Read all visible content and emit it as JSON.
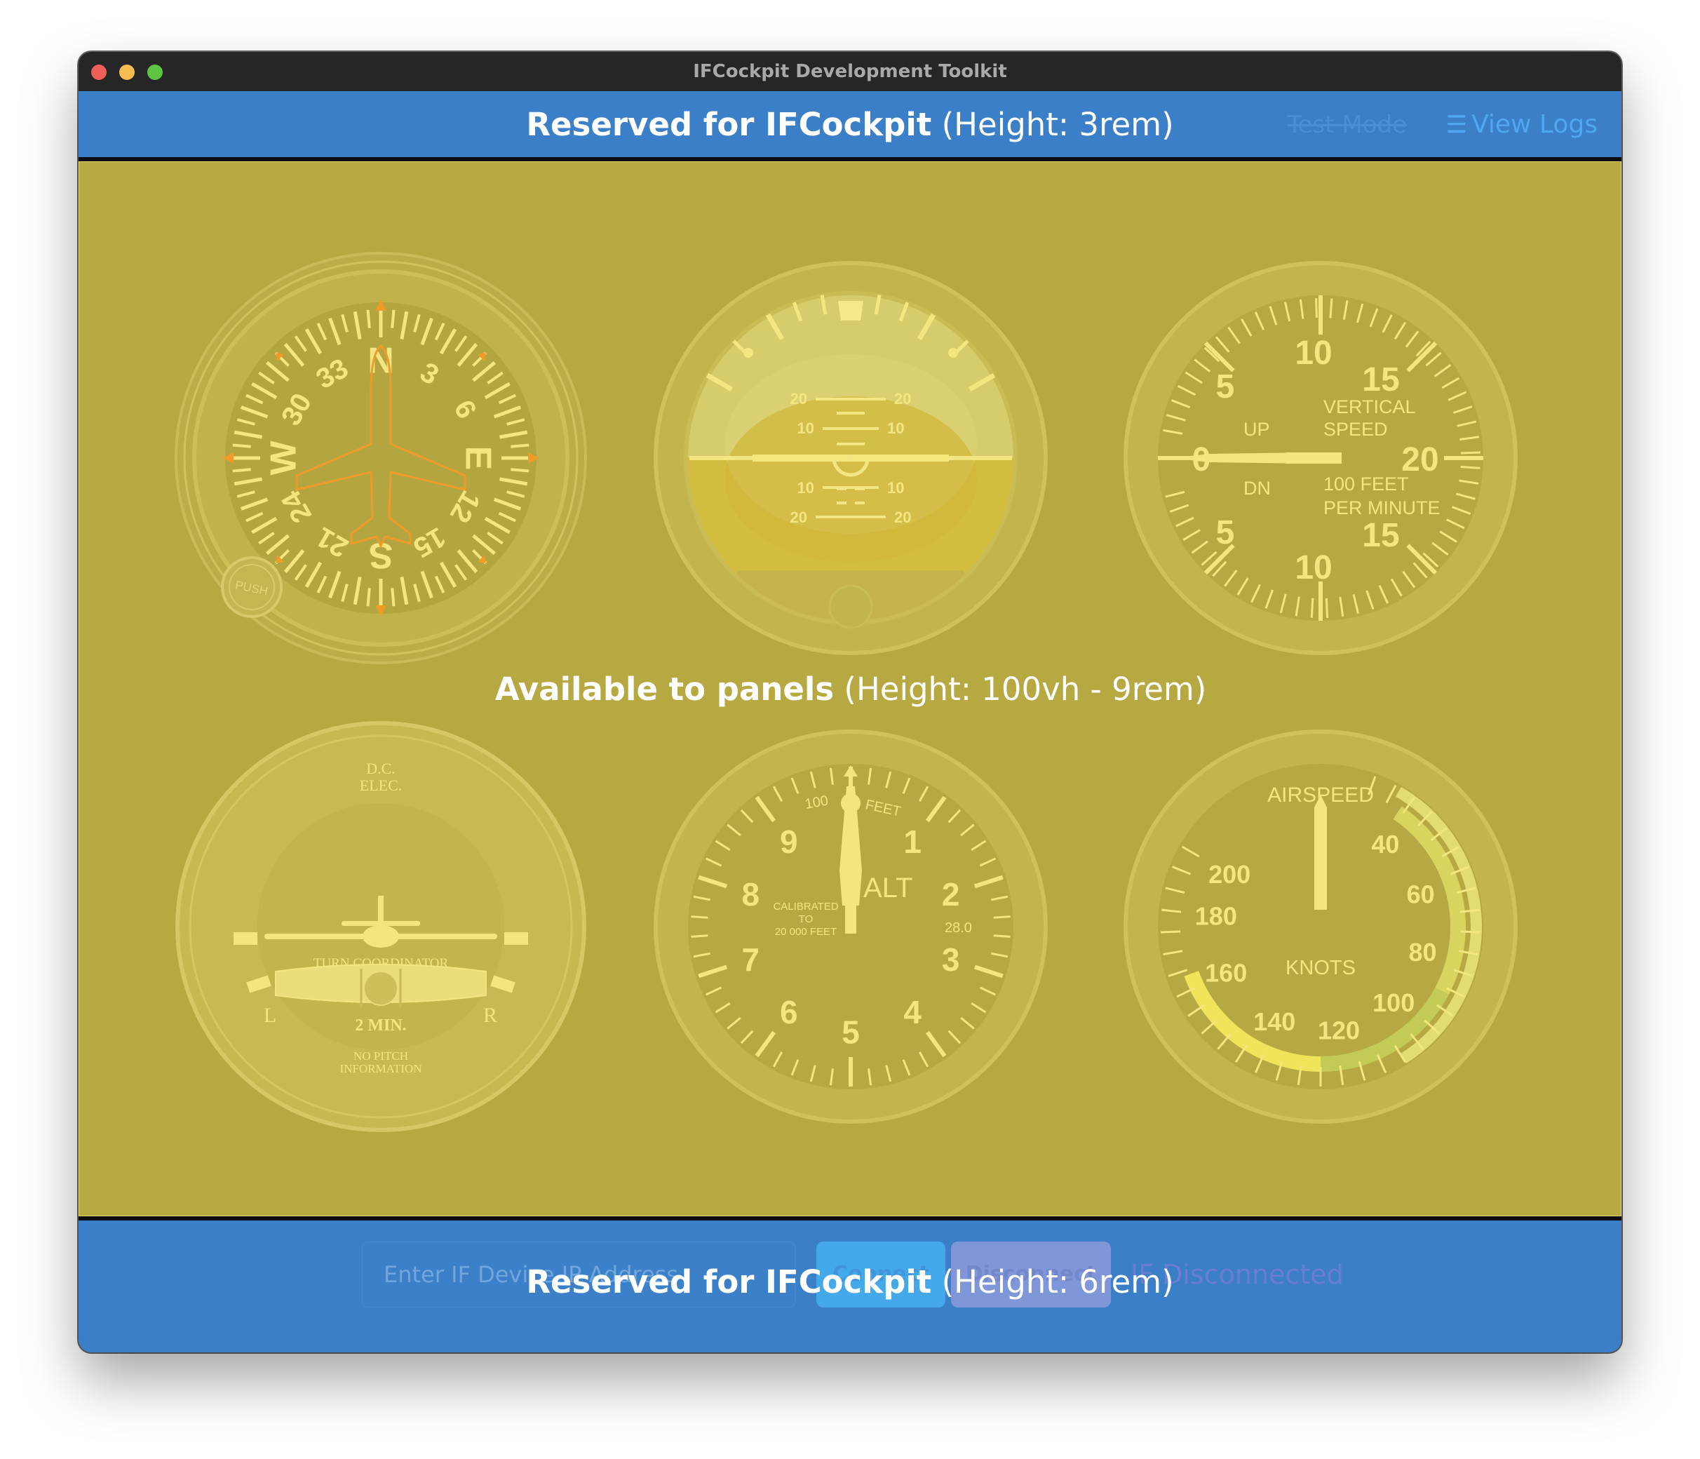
{
  "window": {
    "title": "IFCockpit Development Toolkit"
  },
  "topbar": {
    "reserved_bold": "Reserved for IFCockpit",
    "reserved_note": "(Height: 3rem)",
    "test_mode": "Test Mode",
    "view_logs": "View Logs"
  },
  "panels": {
    "available_bold": "Available to panels",
    "available_note": "(Height: 100vh - 9rem)",
    "heading_indicator": {
      "cardinals": [
        "N",
        "E",
        "S",
        "W"
      ],
      "numbers": [
        "3",
        "6",
        "12",
        "15",
        "21",
        "24",
        "30",
        "33"
      ],
      "push_label": "PUSH"
    },
    "attitude_indicator": {
      "pitch_labels": [
        "20",
        "10",
        "10",
        "20"
      ]
    },
    "vertical_speed": {
      "scale": [
        "0",
        "5",
        "10",
        "15",
        "20",
        "15",
        "10",
        "5"
      ],
      "up": "UP",
      "dn": "DN",
      "title_line1": "VERTICAL",
      "title_line2": "SPEED",
      "unit_line1": "100 FEET",
      "unit_line2": "PER MINUTE"
    },
    "turn_coordinator": {
      "top_line1": "D.C.",
      "top_line2": "ELEC.",
      "title": "TURN COORDINATOR",
      "left": "L",
      "right": "R",
      "min": "2 MIN.",
      "bottom_line1": "NO PITCH",
      "bottom_line2": "INFORMATION"
    },
    "altimeter": {
      "numbers": [
        "0",
        "1",
        "2",
        "3",
        "4",
        "5",
        "6",
        "7",
        "8",
        "9"
      ],
      "label": "ALT",
      "hundred": "100",
      "feet": "FEET",
      "cal_line1": "CALIBRATED",
      "cal_line2": "TO",
      "cal_line3": "20 000 FEET",
      "baro": "28.0"
    },
    "airspeed": {
      "title": "AIRSPEED",
      "units": "KNOTS",
      "scale": [
        "40",
        "60",
        "80",
        "100",
        "120",
        "140",
        "160",
        "180",
        "200"
      ]
    }
  },
  "bottombar": {
    "ip_placeholder": "Enter IF Device IP Address",
    "connect": "Connect",
    "disconnect": "Disconnect",
    "status": "IF Disconnected",
    "reserved_bold": "Reserved for IFCockpit",
    "reserved_note": "(Height: 6rem)"
  },
  "colors": {
    "panel_bg": "#b6a942",
    "bar_bg": "#3a7fc7",
    "gauge_yellow": "#f3e680",
    "heading_orange": "#f09a2a"
  }
}
